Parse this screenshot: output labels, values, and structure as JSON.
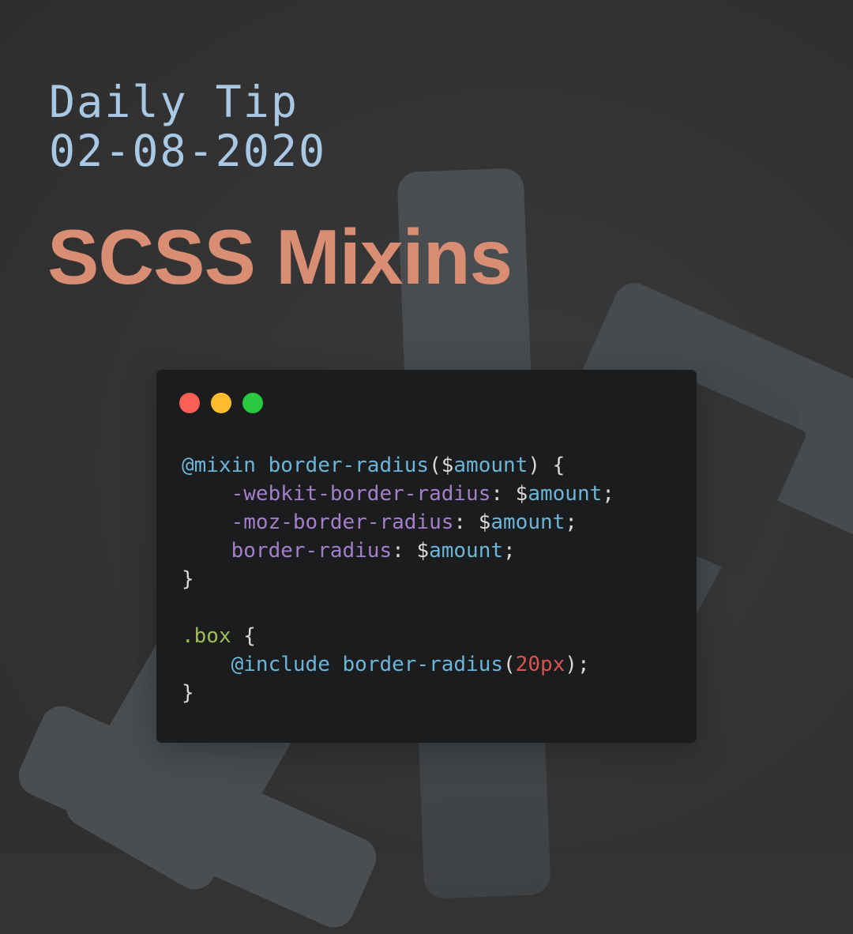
{
  "header": {
    "line1": "Daily Tip",
    "line2": "02-08-2020"
  },
  "title": "SCSS Mixins",
  "colors": {
    "background": "#333334",
    "header_text": "#a9c8e4",
    "title_text": "#d98d73",
    "window_bg": "#1b1c1e",
    "dot_red": "#fe5f57",
    "dot_yellow": "#febc2e",
    "dot_green": "#28c840",
    "keyword": "#6cb5d8",
    "property": "#a47fc9",
    "selector": "#9fbf55",
    "number": "#d9534f",
    "punctuation": "#d9d9d9"
  },
  "window": {
    "controls": [
      "close-dot",
      "minimize-dot",
      "maximize-dot"
    ]
  },
  "code": {
    "lines": [
      [
        {
          "t": "@mixin ",
          "k": "keyword"
        },
        {
          "t": "border-radius",
          "k": "func"
        },
        {
          "t": "(",
          "k": "punct"
        },
        {
          "t": "$",
          "k": "punct"
        },
        {
          "t": "amount",
          "k": "var"
        },
        {
          "t": ") {",
          "k": "punct"
        }
      ],
      [
        {
          "t": "    ",
          "k": "punct"
        },
        {
          "t": "-webkit-border-radius",
          "k": "prop"
        },
        {
          "t": ": ",
          "k": "punct"
        },
        {
          "t": "$",
          "k": "punct"
        },
        {
          "t": "amount",
          "k": "var"
        },
        {
          "t": ";",
          "k": "punct"
        }
      ],
      [
        {
          "t": "    ",
          "k": "punct"
        },
        {
          "t": "-moz-border-radius",
          "k": "prop"
        },
        {
          "t": ": ",
          "k": "punct"
        },
        {
          "t": "$",
          "k": "punct"
        },
        {
          "t": "amount",
          "k": "var"
        },
        {
          "t": ";",
          "k": "punct"
        }
      ],
      [
        {
          "t": "    ",
          "k": "punct"
        },
        {
          "t": "border-radius",
          "k": "prop"
        },
        {
          "t": ": ",
          "k": "punct"
        },
        {
          "t": "$",
          "k": "punct"
        },
        {
          "t": "amount",
          "k": "var"
        },
        {
          "t": ";",
          "k": "punct"
        }
      ],
      [
        {
          "t": "}",
          "k": "punct"
        }
      ],
      [],
      [
        {
          "t": ".box",
          "k": "selector"
        },
        {
          "t": " {",
          "k": "punct"
        }
      ],
      [
        {
          "t": "    ",
          "k": "punct"
        },
        {
          "t": "@include ",
          "k": "keyword"
        },
        {
          "t": "border-radius",
          "k": "func"
        },
        {
          "t": "(",
          "k": "punct"
        },
        {
          "t": "20px",
          "k": "number"
        },
        {
          "t": ");",
          "k": "punct"
        }
      ],
      [
        {
          "t": "}",
          "k": "punct"
        }
      ]
    ]
  }
}
